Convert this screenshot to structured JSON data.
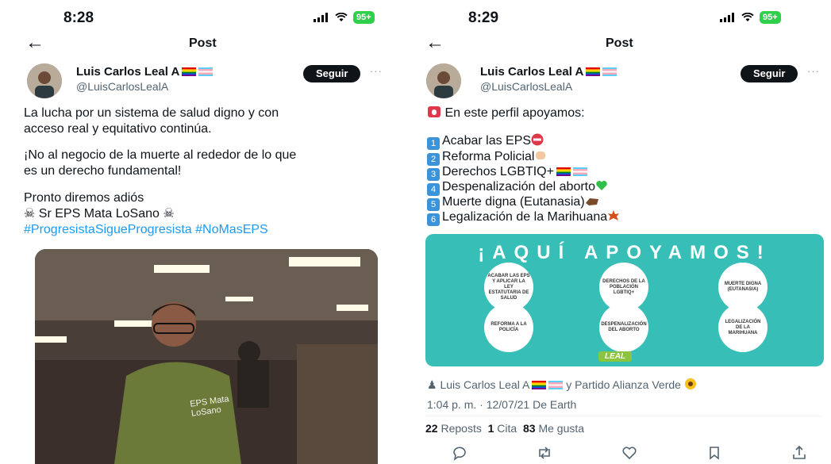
{
  "left": {
    "status": {
      "time": "8:28",
      "battery": "95+"
    },
    "header": {
      "title": "Post"
    },
    "author": {
      "name": "Luis Carlos Leal A",
      "handle": "@LuisCarlosLealA",
      "follow_label": "Seguir"
    },
    "body": {
      "line1": "La lucha por un sistema de salud digno y con",
      "line2": "acceso real y equitativo continúa.",
      "line3": "¡No al negocio de la muerte al rededor de lo que",
      "line4": "es un derecho fundamental!",
      "line5": "Pronto diremos adiós",
      "line6": "Sr EPS Mata LoSano",
      "hashtags": "#ProgresistaSigueProgresista #NoMasEPS"
    },
    "photo_shirt_text": "EPS Mata LoSano"
  },
  "right": {
    "status": {
      "time": "8:29",
      "battery": "95+"
    },
    "header": {
      "title": "Post"
    },
    "author": {
      "name": "Luis Carlos Leal A",
      "handle": "@LuisCarlosLealA",
      "follow_label": "Seguir"
    },
    "body": {
      "intro": "En este perfil apoyamos:",
      "items": [
        {
          "num": "1",
          "text": "Acabar las EPS"
        },
        {
          "num": "2",
          "text": "Reforma Policial"
        },
        {
          "num": "3",
          "text": "Derechos LGBTIQ+"
        },
        {
          "num": "4",
          "text": "Despenalización del aborto"
        },
        {
          "num": "5",
          "text": "Muerte digna (Eutanasia)"
        },
        {
          "num": "6",
          "text": "Legalización de la Marihuana"
        }
      ]
    },
    "infographic": {
      "title": "¡AQUÍ APOYAMOS!",
      "circles": [
        "ACABAR LAS EPS Y APLICAR LA LEY ESTATUTARIA DE SALUD",
        "DERECHOS DE LA POBLACIÓN LGBTIQ+",
        "MUERTE DIGNA (EUTANASIA)",
        "REFORMA A LA POLICÍA",
        "DESPENALIZACIÓN DEL ABORTO",
        "LEGALIZACIÓN DE LA MARIHUANA"
      ],
      "logo": "LEAL"
    },
    "coauthors": {
      "prefix": "Luis Carlos Leal A",
      "suffix": "y Partido Alianza Verde"
    },
    "timestamp": "1:04 p. m. · 12/07/21 De Earth",
    "stats": {
      "reposts_count": "22",
      "reposts_label": "Reposts",
      "quotes_count": "1",
      "quotes_label": "Cita",
      "likes_count": "83",
      "likes_label": "Me gusta"
    }
  },
  "colors": {
    "link": "#1d9bf0",
    "follow_bg": "#0f1419",
    "battery": "#2fcf4c",
    "infographic_bg": "#37bfb7"
  }
}
